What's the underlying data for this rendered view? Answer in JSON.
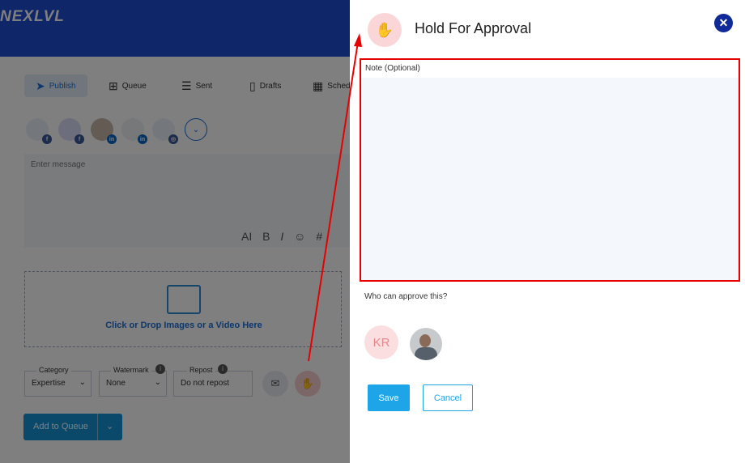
{
  "app": {
    "logo": "NEXLVL"
  },
  "tabs": [
    {
      "label": "Publish",
      "icon": "paper-plane-icon",
      "active": true
    },
    {
      "label": "Queue",
      "icon": "plus-square-icon",
      "active": false
    },
    {
      "label": "Sent",
      "icon": "list-icon",
      "active": false
    },
    {
      "label": "Drafts",
      "icon": "file-icon",
      "active": false
    },
    {
      "label": "Sched",
      "icon": "calendar-icon",
      "active": false
    }
  ],
  "composer": {
    "message_placeholder": "Enter message",
    "format_tools": [
      "AI",
      "B",
      "I",
      "☺",
      "#"
    ]
  },
  "accounts": [
    {
      "badge": "f",
      "badge_color": "#3b5998"
    },
    {
      "badge": "f",
      "badge_color": "#3b5998"
    },
    {
      "badge": "in",
      "badge_color": "#0a66c2"
    },
    {
      "badge": "in",
      "badge_color": "#0a66c2"
    },
    {
      "badge": "◎",
      "badge_color": "#3b5998"
    }
  ],
  "dropzone": {
    "text": "Click or Drop Images or a Video Here"
  },
  "fields": {
    "category": {
      "label": "Category",
      "value": "Expertise"
    },
    "watermark": {
      "label": "Watermark",
      "value": "None"
    },
    "repost": {
      "label": "Repost",
      "value": "Do not repost"
    }
  },
  "add_to_queue": {
    "label": "Add to Queue"
  },
  "modal": {
    "title": "Hold For Approval",
    "note_label": "Note (Optional)",
    "note_value": "",
    "who_label": "Who can approve this?",
    "approvers": [
      {
        "initials": "KR",
        "type": "initials"
      },
      {
        "initials": "",
        "type": "photo"
      }
    ],
    "save_label": "Save",
    "cancel_label": "Cancel"
  },
  "colors": {
    "brand_blue": "#1e4fd0",
    "accent_blue": "#1ea5e8",
    "hold_red": "#e0424a",
    "annotation_red": "#e60000"
  }
}
